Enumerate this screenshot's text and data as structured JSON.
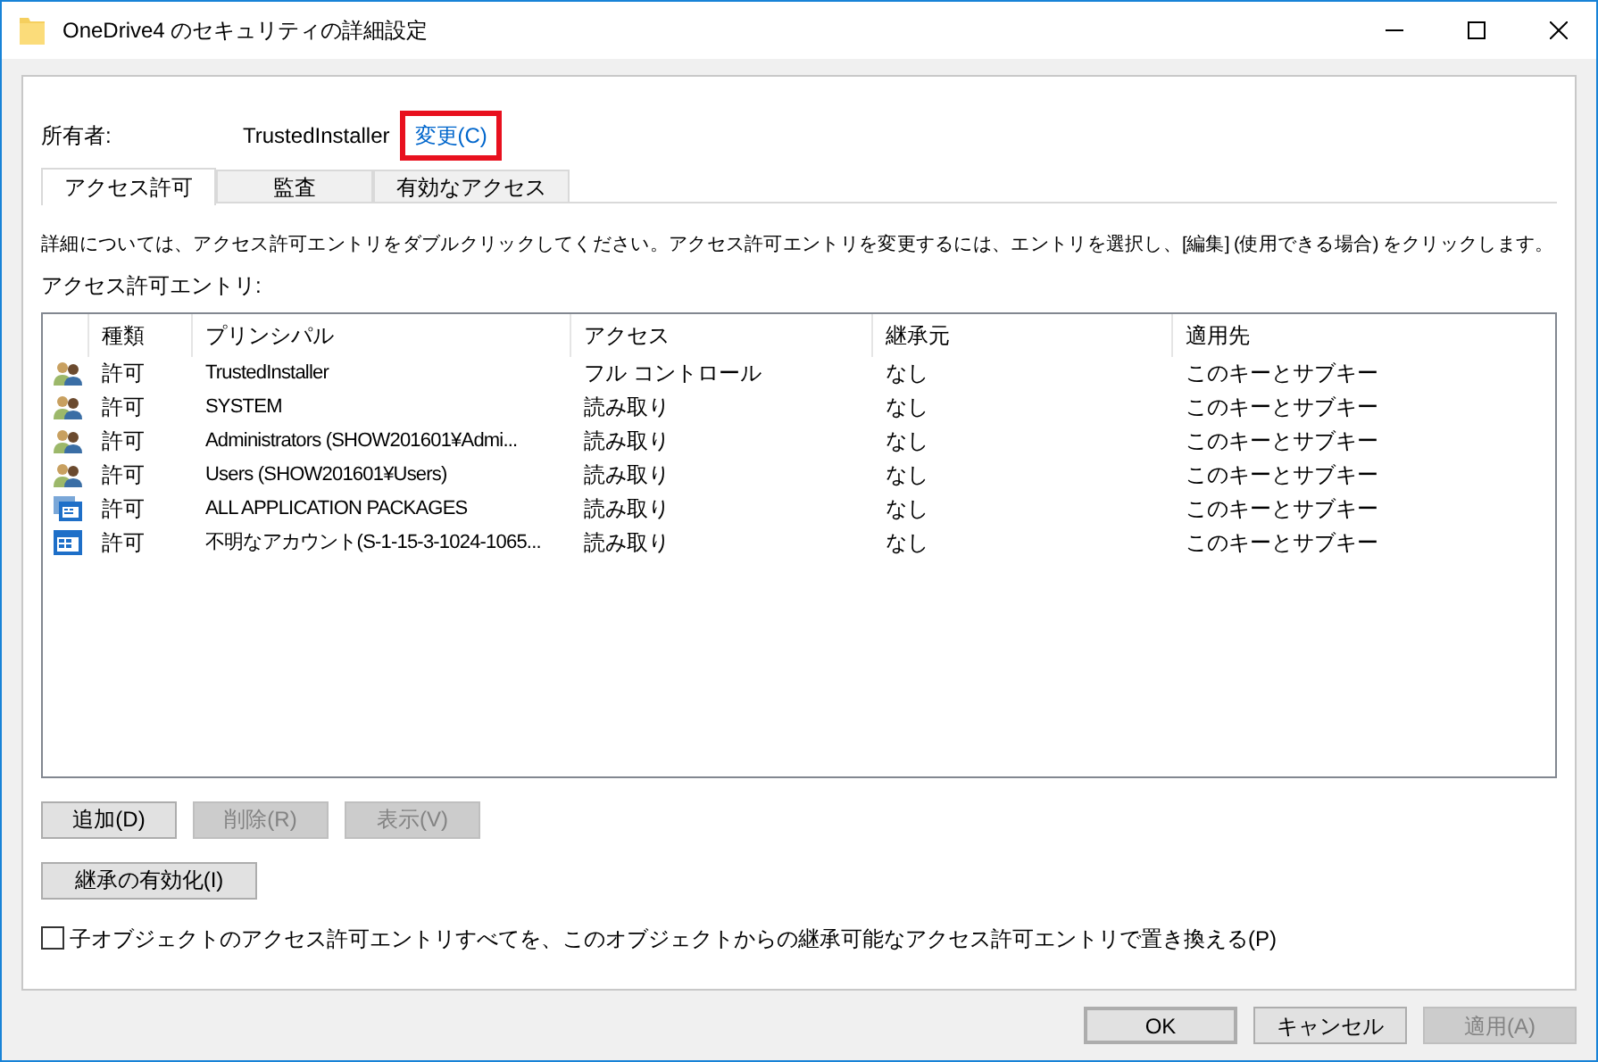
{
  "window": {
    "title": "OneDrive4 のセキュリティの詳細設定"
  },
  "owner": {
    "label": "所有者:",
    "value": "TrustedInstaller",
    "change_link": {
      "text": "変更(C)",
      "highlighted": true
    }
  },
  "tabs": [
    {
      "label": "アクセス許可",
      "selected": true
    },
    {
      "label": "監査",
      "selected": false
    },
    {
      "label": "有効なアクセス",
      "selected": false
    }
  ],
  "instructions": "詳細については、アクセス許可エントリをダブルクリックしてください。アクセス許可エントリを変更するには、エントリを選択し、[編集] (使用できる場合) をクリックします。",
  "entries_label": "アクセス許可エントリ:",
  "table": {
    "columns": [
      "種類",
      "プリンシパル",
      "アクセス",
      "継承元",
      "適用先"
    ],
    "rows": [
      {
        "kind": "group",
        "type": "許可",
        "principal": "TrustedInstaller",
        "access": "フル コントロール",
        "inherited_from": "なし",
        "applies_to": "このキーとサブキー"
      },
      {
        "kind": "group",
        "type": "許可",
        "principal": "SYSTEM",
        "access": "読み取り",
        "inherited_from": "なし",
        "applies_to": "このキーとサブキー"
      },
      {
        "kind": "group",
        "type": "許可",
        "principal": "Administrators (SHOW201601¥Admi...",
        "access": "読み取り",
        "inherited_from": "なし",
        "applies_to": "このキーとサブキー"
      },
      {
        "kind": "group",
        "type": "許可",
        "principal": "Users (SHOW201601¥Users)",
        "access": "読み取り",
        "inherited_from": "なし",
        "applies_to": "このキーとサブキー"
      },
      {
        "kind": "package",
        "type": "許可",
        "principal": "ALL APPLICATION PACKAGES",
        "access": "読み取り",
        "inherited_from": "なし",
        "applies_to": "このキーとサブキー"
      },
      {
        "kind": "app",
        "type": "許可",
        "principal": "不明なアカウント(S-1-15-3-1024-1065...",
        "access": "読み取り",
        "inherited_from": "なし",
        "applies_to": "このキーとサブキー"
      }
    ]
  },
  "entry_buttons": [
    {
      "label": "追加(D)",
      "disabled": false
    },
    {
      "label": "削除(R)",
      "disabled": true
    },
    {
      "label": "表示(V)",
      "disabled": true
    }
  ],
  "inheritance_button": {
    "label": "継承の有効化(I)",
    "disabled": false
  },
  "replace_checkbox": {
    "label": "子オブジェクトのアクセス許可エントリすべてを、このオブジェクトからの継承可能なアクセス許可エントリで置き換える(P)",
    "checked": false
  },
  "dialog_buttons": [
    {
      "label": "OK",
      "disabled": false,
      "default": true
    },
    {
      "label": "キャンセル",
      "disabled": false,
      "default": false
    },
    {
      "label": "適用(A)",
      "disabled": true,
      "default": false
    }
  ]
}
